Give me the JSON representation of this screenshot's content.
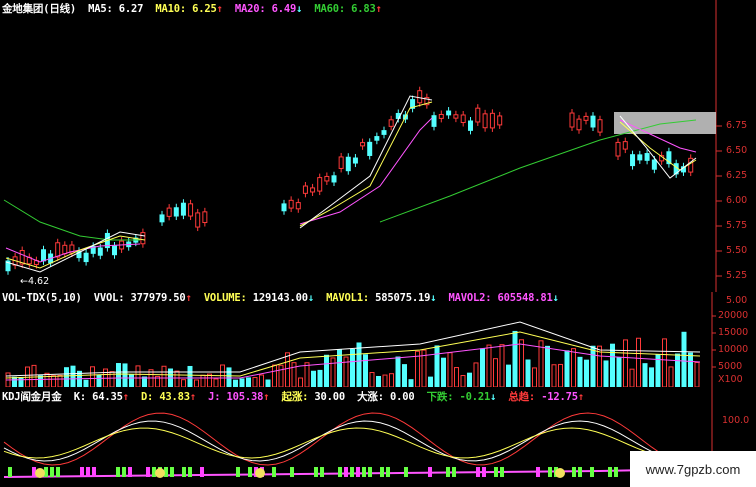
{
  "price_header": {
    "stock_name": "金地集团(日线)",
    "ma5_label": "MA5:",
    "ma5_value": "6.27",
    "ma10_label": "MA10:",
    "ma10_value": "6.25",
    "ma20_label": "MA20:",
    "ma20_value": "6.49",
    "ma60_label": "MA60:",
    "ma60_value": "6.83",
    "arrow_up": "↑",
    "arrow_down": "↓"
  },
  "price_axis": [
    "6.75",
    "6.50",
    "6.25",
    "6.00",
    "5.75",
    "5.50",
    "5.25",
    "5.00"
  ],
  "low_marker": "←4.62",
  "volume_header": {
    "indicator": "VOL-TDX(5,10)",
    "vvol_label": "VVOL:",
    "vvol_value": "377979.50",
    "volume_label": "VOLUME:",
    "volume_value": "129143.00",
    "mavol1_label": "MAVOL1:",
    "mavol1_value": "585075.19",
    "mavol2_label": "MAVOL2:",
    "mavol2_value": "605548.81"
  },
  "volume_axis": [
    "20000",
    "15000",
    "10000",
    "5000"
  ],
  "volume_unit": "X100",
  "kdj_header": {
    "indicator": "KDJ阎金月金",
    "k_label": "K:",
    "k_value": "64.35",
    "d_label": "D:",
    "d_value": "43.83",
    "j_label": "J:",
    "j_value": "105.38",
    "qizhang_label": "起涨:",
    "qizhang_value": "30.00",
    "dazhang_label": "大涨:",
    "dazhang_value": "0.00",
    "xiadie_label": "下跌:",
    "xiadie_value": "-0.21",
    "zongqu_label": "总趋:",
    "zongqu_value": "-12.75"
  },
  "kdj_axis": [
    "100.0"
  ],
  "watermark": "www.7gpzb.com",
  "colors": {
    "up": "#ff3a3a",
    "down": "#54ffff",
    "ma5": "#ffffff",
    "ma10": "#ffff55",
    "ma20": "#ff55ff",
    "ma60": "#33cc33",
    "axis": "#d83030"
  }
}
